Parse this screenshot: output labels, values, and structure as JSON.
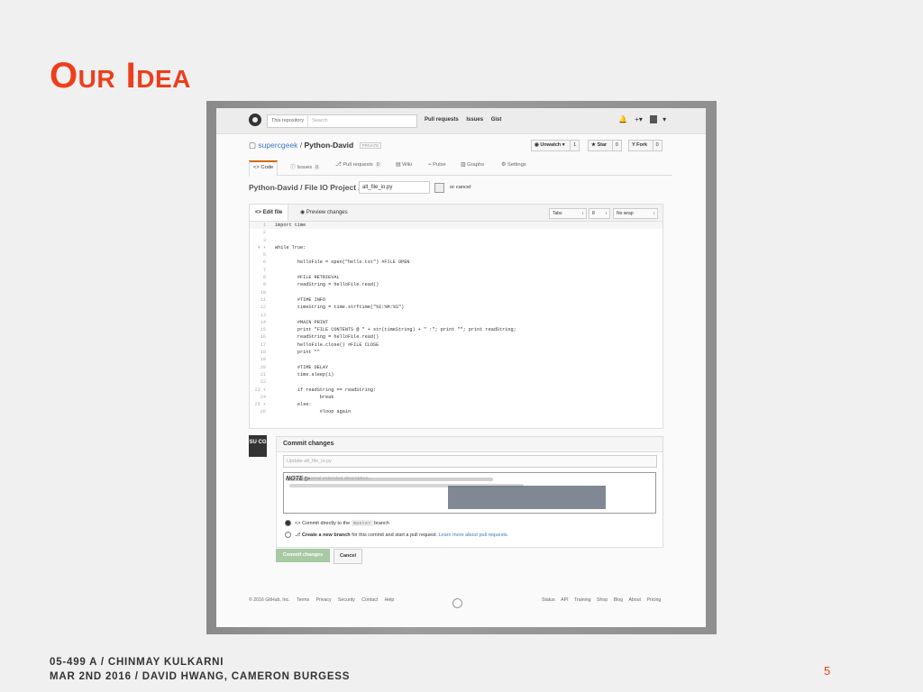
{
  "slide": {
    "title": "Our Idea",
    "footer_line1": "05-499 A / CHINMAY KULKARNI",
    "footer_line2": "MAR 2ND 2016 / DAVID HWANG, CAMERON BURGESS",
    "page_number": "5",
    "accent_color": "#ee3e1c"
  },
  "header": {
    "search_scope": "This repository",
    "search_placeholder": "Search",
    "nav": [
      "Pull requests",
      "Issues",
      "Gist"
    ],
    "icons": [
      "bell-icon",
      "plus-icon",
      "avatar"
    ]
  },
  "repo": {
    "owner": "supercgeek",
    "name": "Python-David",
    "visibility": "PRIVATE",
    "unwatch_label": "Unwatch ▾",
    "watch_count": "1",
    "star_label": "Star",
    "star_count": "0",
    "fork_label": "Fork",
    "fork_count": "0"
  },
  "tabs": [
    {
      "label": "Code"
    },
    {
      "label": "Issues",
      "count": "0"
    },
    {
      "label": "Pull requests",
      "count": "0"
    },
    {
      "label": "Wiki"
    },
    {
      "label": "Pulse"
    },
    {
      "label": "Graphs"
    },
    {
      "label": "Settings"
    }
  ],
  "breadcrumb": {
    "path": "Python-David / File IO Project /",
    "filename": "alt_file_io.py",
    "cancel_text": "or cancel"
  },
  "editor": {
    "tab_edit": "Edit file",
    "tab_preview": "Preview changes",
    "indent_mode": "Tabs",
    "indent_size": "8",
    "wrap_mode": "No wrap",
    "lines": [
      "import time",
      "",
      "",
      "while True:",
      "",
      "        helloFile = open(\"hello.txt\") #FILE OPEN",
      "",
      "        #FILE RETRIEVAL",
      "        readString = helloFile.read()",
      "",
      "        #TIME INFO",
      "        timeString = time.strftime(\"%I:%M:%S\")",
      "",
      "        #MAIN PRINT",
      "        print \"FILE CONTENTS @ \" + str(timeString) + \" :\"; print \"\"; print readString;",
      "        readString = helloFile.read()",
      "        helloFile.close() #FILE CLOSE",
      "        print \"\"",
      "",
      "        #TIME DELAY",
      "        time.sleep(1)",
      "",
      "        if readString == readString:",
      "                break",
      "        else:",
      "                #loop again"
    ],
    "line_numbers": [
      "1",
      "2",
      "3",
      "4 ▾",
      "5",
      "6",
      "7",
      "8",
      "9",
      "10",
      "11",
      "12",
      "13",
      "14",
      "15",
      "16",
      "17",
      "18",
      "19",
      "20",
      "21",
      "22",
      "23 ▾",
      "24",
      "25 ▾",
      "26"
    ]
  },
  "commit": {
    "avatar_text": "SU CG",
    "heading": "Commit changes",
    "summary_placeholder": "Update alt_file_io.py",
    "description_placeholder": "Add an optional extended description...",
    "handwritten_note": "NOTE ▷",
    "option_direct": "Commit directly to the",
    "branch_name": "master",
    "option_direct_suffix": "branch",
    "option_new_bold": "Create a new branch",
    "option_new_rest": "for this commit and start a pull request.",
    "learn_more": "Learn more about pull requests.",
    "commit_button": "Commit changes",
    "cancel_button": "Cancel"
  },
  "gh_footer": {
    "left": [
      "© 2016 GitHub, Inc.",
      "Terms",
      "Privacy",
      "Security",
      "Contact",
      "Help"
    ],
    "right": [
      "Status",
      "API",
      "Training",
      "Shop",
      "Blog",
      "About",
      "Pricing"
    ]
  }
}
